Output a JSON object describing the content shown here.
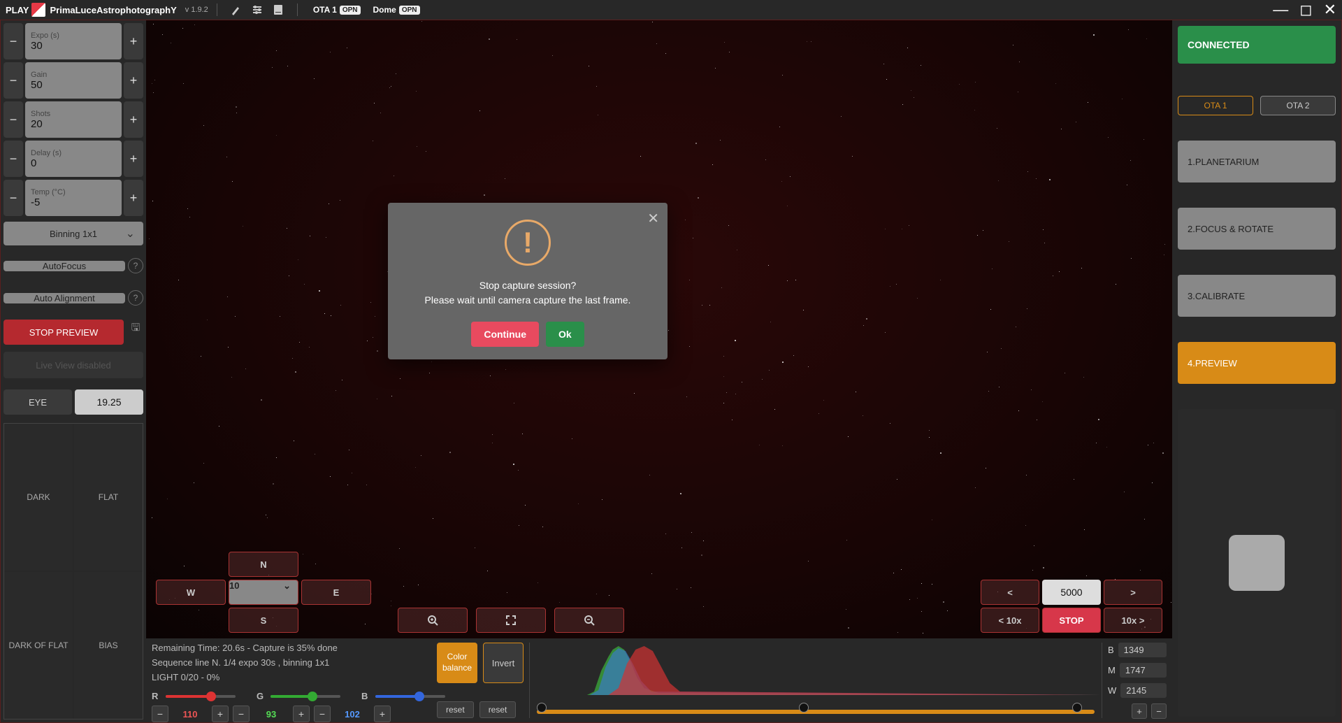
{
  "titlebar": {
    "play": "PLAY",
    "brand": "PrimaLuceAstrophotographY",
    "version": "v 1.9.2",
    "ota1_label": "OTA 1",
    "ota1_status": "OPN",
    "dome_label": "Dome",
    "dome_status": "OPN"
  },
  "left": {
    "expo_label": "Expo (s)",
    "expo_value": "30",
    "gain_label": "Gain",
    "gain_value": "50",
    "shots_label": "Shots",
    "shots_value": "20",
    "delay_label": "Delay (s)",
    "delay_value": "0",
    "temp_label": "Temp (°C)",
    "temp_value": "-5",
    "binning": "Binning 1x1",
    "autofocus": "AutoFocus",
    "autoalign": "Auto Alignment",
    "stop_preview": "STOP PREVIEW",
    "live_disabled": "Live View disabled",
    "eye_label": "EYE",
    "eye_value": "19.25",
    "cal_dark": "DARK",
    "cal_flat": "FLAT",
    "cal_darkflat": "DARK OF FLAT",
    "cal_bias": "BIAS"
  },
  "dirpad": {
    "n": "N",
    "w": "W",
    "e": "E",
    "s": "S",
    "speed": "10"
  },
  "focuspad": {
    "lt": "<",
    "gt": ">",
    "val": "5000",
    "lt10": "< 10x",
    "stop": "STOP",
    "gt10": "10x >"
  },
  "status": {
    "line1": "Remaining Time: 20.6s  -  Capture is 35% done",
    "line2": "Sequence line N. 1/4 expo 30s , binning 1x1",
    "line3": "LIGHT 0/20 - 0%",
    "r_label": "R",
    "g_label": "G",
    "b_label": "B",
    "r_val": "110",
    "g_val": "93",
    "b_val": "102",
    "reset": "reset",
    "color_balance": "Color balance",
    "invert": "Invert",
    "bmw_b_label": "B",
    "bmw_b": "1349",
    "bmw_m_label": "M",
    "bmw_m": "1747",
    "bmw_w_label": "W",
    "bmw_w": "2145"
  },
  "right": {
    "connected": "CONNECTED",
    "ota1": "OTA 1",
    "ota2": "OTA 2",
    "nav1": "1.PLANETARIUM",
    "nav2": "2.FOCUS & ROTATE",
    "nav3": "3.CALIBRATE",
    "nav4": "4.PREVIEW"
  },
  "modal": {
    "line1": "Stop capture session?",
    "line2": "Please wait until camera capture the last frame.",
    "continue": "Continue",
    "ok": "Ok"
  }
}
